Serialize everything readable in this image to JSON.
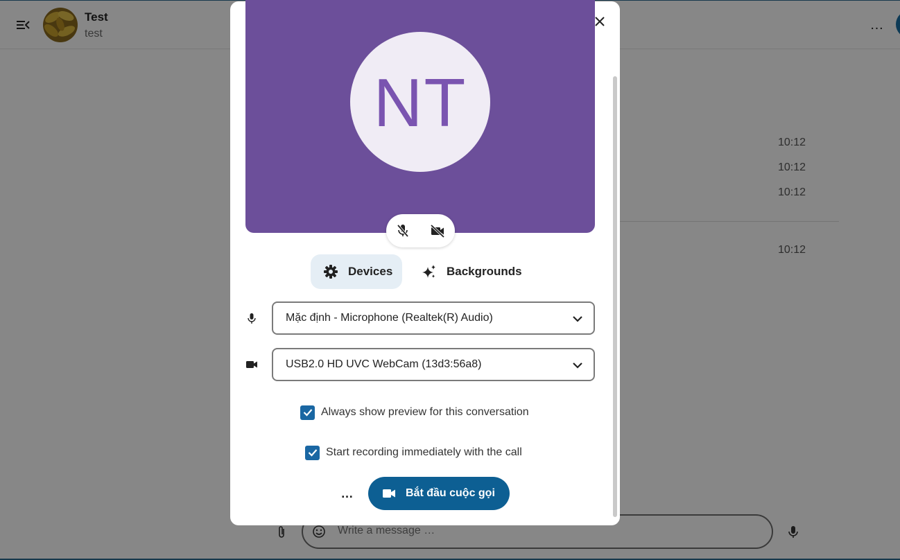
{
  "conversation": {
    "title": "Test",
    "subtitle": "test",
    "more_label": "…"
  },
  "messages": {
    "times": [
      "10:12",
      "10:12",
      "10:12",
      "10:12"
    ]
  },
  "composer": {
    "placeholder": "Write a message …"
  },
  "modal": {
    "preview": {
      "initials": "NT",
      "avatar_bg": "#6c4f9a",
      "initials_color": "#7a54b0"
    },
    "tabs": [
      {
        "label": "Devices",
        "icon": "gear-icon",
        "active": true
      },
      {
        "label": "Backgrounds",
        "icon": "sparkles-icon",
        "active": false
      }
    ],
    "devices": {
      "microphone": "Mặc định - Microphone (Realtek(R) Audio)",
      "camera": "USB2.0 HD UVC WebCam (13d3:56a8)"
    },
    "options": {
      "always_preview": "Always show preview for this conversation",
      "start_recording": "Start recording immediately with the call"
    },
    "actions": {
      "more_label": "…",
      "start_call": "Bắt đầu cuộc gọi"
    }
  },
  "colors": {
    "primary": "#0d5f93",
    "checkbox": "#1a67a3",
    "tab_active_bg": "#e5eef5"
  }
}
